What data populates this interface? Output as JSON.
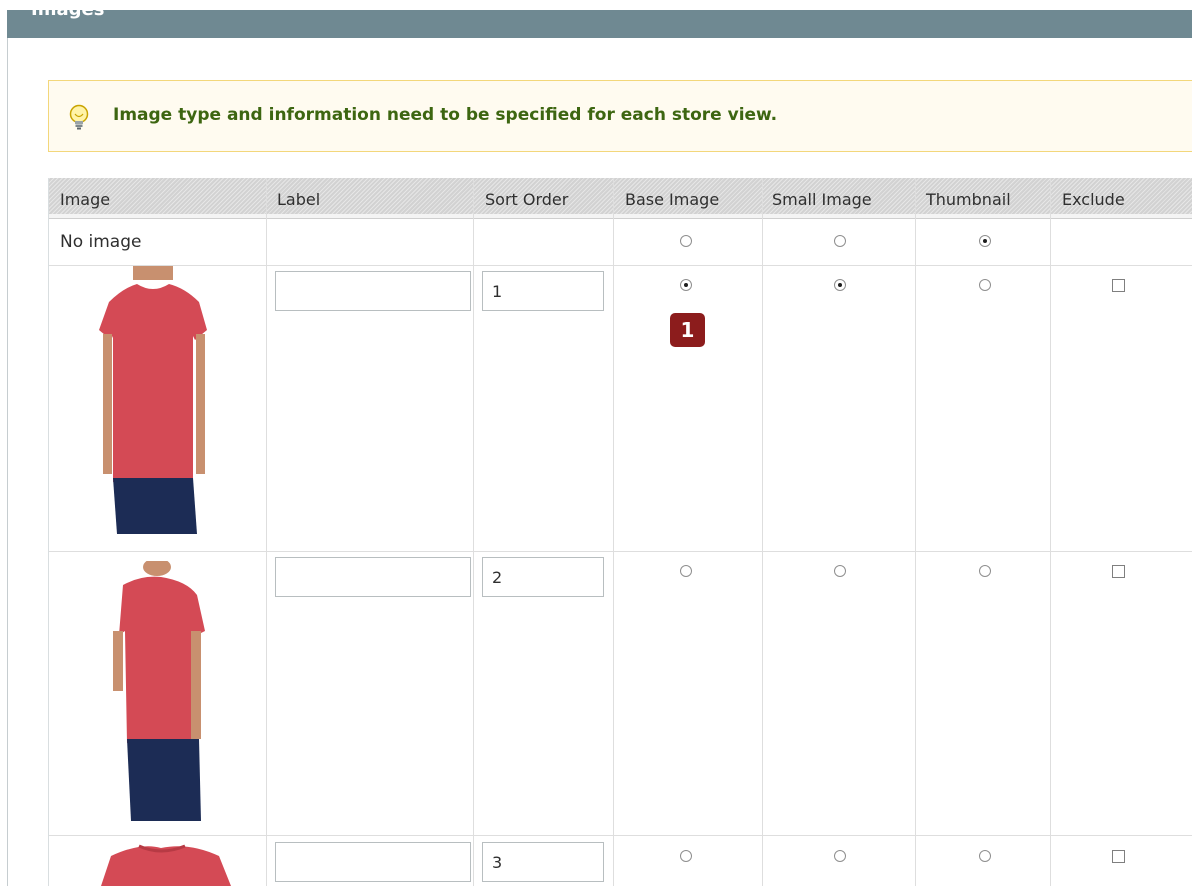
{
  "section": {
    "title": "Images"
  },
  "notice": {
    "icon": "lightbulb-icon",
    "text": "Image type and information need to be specified for each store view."
  },
  "grid": {
    "headers": {
      "image": "Image",
      "label": "Label",
      "sort_order": "Sort Order",
      "base_image": "Base Image",
      "small_image": "Small Image",
      "thumbnail": "Thumbnail",
      "exclude": "Exclude"
    },
    "no_image_row": {
      "label": "No image",
      "base_image_selected": false,
      "small_image_selected": false,
      "thumbnail_selected": true
    },
    "rows": [
      {
        "image": "tshirt-front-photo",
        "label": "",
        "sort_order": "1",
        "base_image_selected": true,
        "small_image_selected": true,
        "thumbnail_selected": false,
        "exclude_checked": false,
        "badge": "1"
      },
      {
        "image": "tshirt-side-photo",
        "label": "",
        "sort_order": "2",
        "base_image_selected": false,
        "small_image_selected": false,
        "thumbnail_selected": false,
        "exclude_checked": false
      },
      {
        "image": "tshirt-back-photo",
        "label": "",
        "sort_order": "3",
        "base_image_selected": false,
        "small_image_selected": false,
        "thumbnail_selected": false,
        "exclude_checked": false
      }
    ]
  },
  "colors": {
    "header_bar": "#6f8992",
    "notice_background": "#fffbf0",
    "notice_border": "#f3d77b",
    "notice_text": "#3d6611",
    "badge": "#8c1c1c",
    "shirt_red": "#d44a55",
    "jeans_blue": "#1c2c55"
  }
}
